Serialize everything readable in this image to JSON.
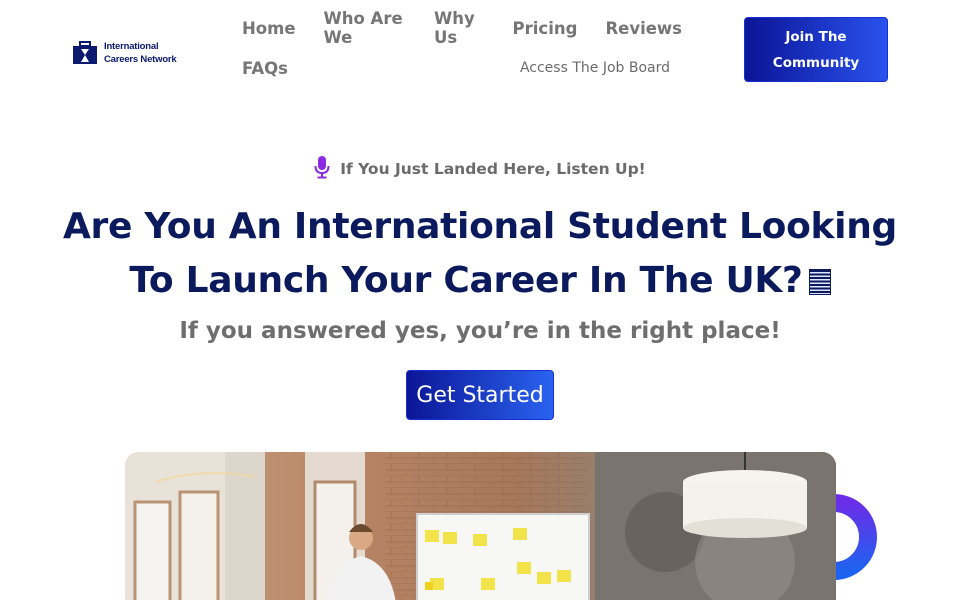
{
  "brand": {
    "line1": "International",
    "line2": "Careers Network",
    "logo_icon": "briefcase-hourglass-icon",
    "color": "#0b1a6e"
  },
  "nav": {
    "items": [
      "Home",
      "Who Are We",
      "Why Us",
      "Pricing",
      "Reviews"
    ],
    "faqs": "FAQs",
    "job_board": "Access The Job Board"
  },
  "join_button": {
    "line1": "Join The",
    "line2": "Community"
  },
  "hero": {
    "eyebrow_icon": "microphone-icon",
    "eyebrow": "If You Just Landed Here, Listen Up!",
    "headline_line1": "Are You An International Student Looking",
    "headline_line2": "To Launch Your Career In The UK?",
    "flag_icon": "uk-flag-icon",
    "subheadline": "If you answered yes, you’re in the right place!",
    "cta": "Get Started"
  },
  "colors": {
    "navy": "#0b1a5c",
    "button_gradient_start": "#0b1596",
    "button_gradient_end": "#2a52ee",
    "muted_text": "#767676",
    "mic_purple": "#8a2be2"
  }
}
